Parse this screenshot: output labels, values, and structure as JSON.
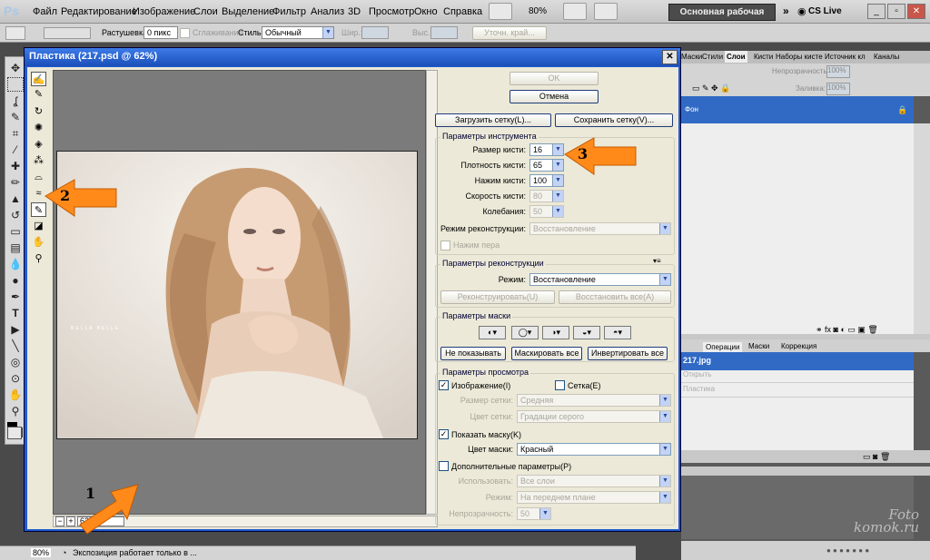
{
  "menu": {
    "logo": "Ps",
    "items": [
      "Файл",
      "Редактирование",
      "Изображение",
      "Слои",
      "Выделение",
      "Фильтр",
      "Анализ",
      "3D",
      "Просмотр",
      "Окно",
      "Справка"
    ],
    "zoom": "80%",
    "workspace": "Основная рабочая среда",
    "cslive": "CS Live"
  },
  "options": {
    "feather_label": "Растушевка:",
    "feather_value": "0 пикс",
    "antialias_label": "Сглаживание",
    "style_label": "Стиль:",
    "style_value": "Обычный",
    "width_label": "Шир.:",
    "height_label": "Выс.:",
    "refine_label": "Уточн. край..."
  },
  "dialog": {
    "title": "Пластика (217.psd @ 62%)",
    "close": "✕",
    "ok": "OK",
    "cancel": "Отмена",
    "load_mesh": "Загрузить сетку(L)...",
    "save_mesh": "Сохранить сетку(V)...",
    "tool_options": {
      "label": "Параметры инструмента",
      "brush_size_label": "Размер кисти:",
      "brush_size": "16",
      "brush_density_label": "Плотность кисти:",
      "brush_density": "65",
      "brush_pressure_label": "Нажим кисти:",
      "brush_pressure": "100",
      "brush_rate_label": "Скорость кисти:",
      "brush_rate": "80",
      "turbulence_label": "Колебания:",
      "turbulence": "50",
      "recon_mode_label": "Режим реконструкции:",
      "recon_mode": "Восстановление",
      "stylus_label": "Нажим пера"
    },
    "reconstruct_options": {
      "label": "Параметры реконструкции",
      "mode_label": "Режим:",
      "mode": "Восстановление",
      "reconstruct": "Реконструировать(U)",
      "restore_all": "Восстановить все(A)"
    },
    "mask_options": {
      "label": "Параметры маски",
      "none": "Не показывать",
      "mask_all": "Маскировать все",
      "invert_all": "Инвертировать все"
    },
    "view_options": {
      "label": "Параметры просмотра",
      "image": "Изображение(I)",
      "mesh": "Сетка(E)",
      "mesh_size_label": "Размер сетки:",
      "mesh_size": "Средняя",
      "mesh_color_label": "Цвет сетки:",
      "mesh_color": "Градации серого",
      "show_mask": "Показать маску(K)",
      "mask_color_label": "Цвет маски:",
      "mask_color": "Красный",
      "extra": "Дополнительные параметры(P)",
      "use_label": "Использовать:",
      "use": "Все слои",
      "mode_label": "Режим:",
      "mode": "На переднем плане",
      "opacity_label": "Непрозрачность:",
      "opacity": "50"
    },
    "zoom": "62%",
    "watermark": "BELLA BELLE"
  },
  "panels": {
    "tabs_top": [
      "Маски",
      "Стили",
      "Слои",
      "Кисти",
      "Наборы кисте",
      "Источник кл",
      "Каналы"
    ],
    "opacity_label": "Непрозрачность:",
    "opacity": "100%",
    "fill_label": "Заливка:",
    "fill": "100%",
    "layer_name": "Фон",
    "tabs_mid": [
      "Операции",
      "Маски",
      "Коррекция"
    ],
    "history_file": "217.jpg",
    "history": [
      "Открыть",
      "Пластика"
    ]
  },
  "status": {
    "zoom": "80%",
    "info": "Экспозиция работает только в ..."
  },
  "callouts": [
    "1",
    "2",
    "3"
  ],
  "watermark_site": {
    "line1": "Foto",
    "line2": "komok.ru"
  },
  "colors": {
    "accent": "#ff8a1a",
    "selection": "#316ac5",
    "dialog_frame": "#1f5bd0"
  }
}
